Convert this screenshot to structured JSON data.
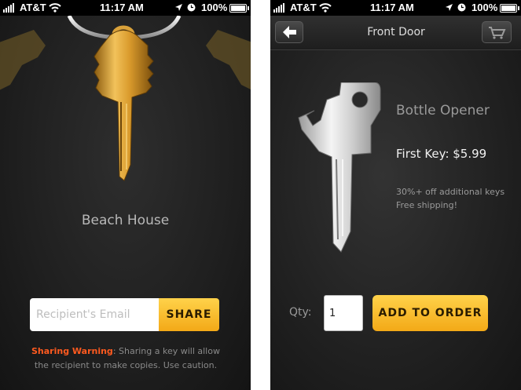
{
  "status_bar": {
    "carrier": "AT&T",
    "time": "11:17 AM",
    "battery": "100%"
  },
  "share_screen": {
    "key_name": "Beach House",
    "email_placeholder": "Recipient's Email",
    "share_label": "SHARE",
    "warning_label": "Sharing Warning",
    "warning_text": ": Sharing a key will allow the recipient to make copies.  Use caution."
  },
  "product_screen": {
    "nav_title": "Front Door",
    "product_name": "Bottle Opener",
    "price": "First Key: $5.99",
    "promo_line1": "30%+ off additional keys",
    "promo_line2": "Free shipping!",
    "qty_label": "Qty:",
    "qty_value": "1",
    "add_label": "ADD TO ORDER"
  },
  "colors": {
    "accent": "#f7b82b",
    "warning": "#ff5a1f"
  }
}
